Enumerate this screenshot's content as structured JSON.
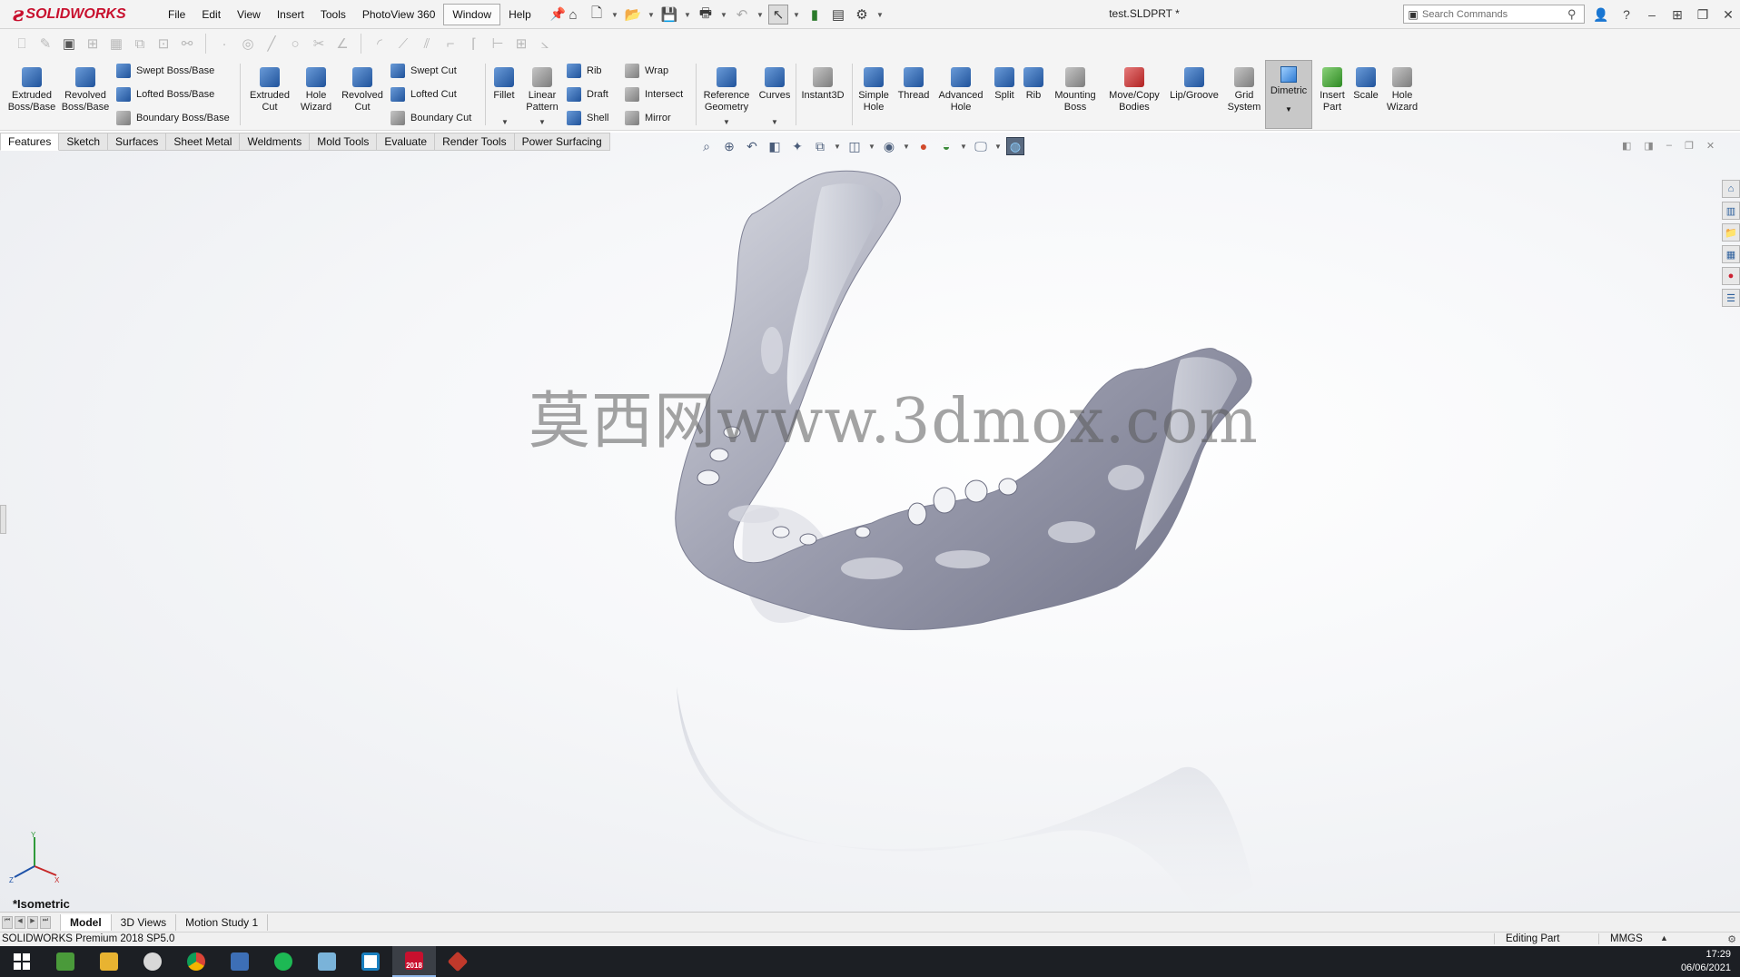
{
  "app": {
    "brand": "SOLIDWORKS",
    "document_title": "test.SLDPRT *"
  },
  "menu": [
    "File",
    "Edit",
    "View",
    "Insert",
    "Tools",
    "PhotoView 360",
    "Window",
    "Help"
  ],
  "search": {
    "placeholder": "Search Commands"
  },
  "ribbon": {
    "extruded_boss": "Extruded Boss/Base",
    "revolved_boss": "Revolved Boss/Base",
    "swept_boss": "Swept Boss/Base",
    "lofted_boss": "Lofted Boss/Base",
    "boundary_boss": "Boundary Boss/Base",
    "extruded_cut": "Extruded Cut",
    "hole_wizard": "Hole Wizard",
    "revolved_cut": "Revolved Cut",
    "swept_cut": "Swept Cut",
    "lofted_cut": "Lofted Cut",
    "boundary_cut": "Boundary Cut",
    "fillet": "Fillet",
    "linear_pattern": "Linear Pattern",
    "rib": "Rib",
    "draft": "Draft",
    "shell": "Shell",
    "wrap": "Wrap",
    "intersect": "Intersect",
    "mirror": "Mirror",
    "reference_geometry": "Reference Geometry",
    "curves": "Curves",
    "instant3d": "Instant3D",
    "simple_hole": "Simple Hole",
    "thread": "Thread",
    "advanced_hole": "Advanced Hole",
    "split": "Split",
    "rib2": "Rib",
    "mounting_boss": "Mounting Boss",
    "move_copy_bodies": "Move/Copy Bodies",
    "lip_groove": "Lip/Groove",
    "grid_system": "Grid System",
    "dimetric": "Dimetric",
    "insert_part": "Insert Part",
    "scale": "Scale",
    "hole_wizard2": "Hole Wizard"
  },
  "tabs": [
    "Features",
    "Sketch",
    "Surfaces",
    "Sheet Metal",
    "Weldments",
    "Mold Tools",
    "Evaluate",
    "Render Tools",
    "Power Surfacing"
  ],
  "viewport": {
    "watermark": "莫西网www.3dmox.com",
    "view_label": "*Isometric"
  },
  "bottom_tabs": [
    "Model",
    "3D Views",
    "Motion Study 1"
  ],
  "status": {
    "product": "SOLIDWORKS Premium 2018 SP5.0",
    "mode": "Editing Part",
    "units": "MMGS"
  },
  "taskbar": {
    "time": "17:29",
    "date": "06/06/2021",
    "sw_badge": "2018"
  },
  "colors": {
    "brand_red": "#c8102e",
    "ribbon_bg": "#f4f4f4",
    "taskbar_bg": "#1c1f24"
  }
}
